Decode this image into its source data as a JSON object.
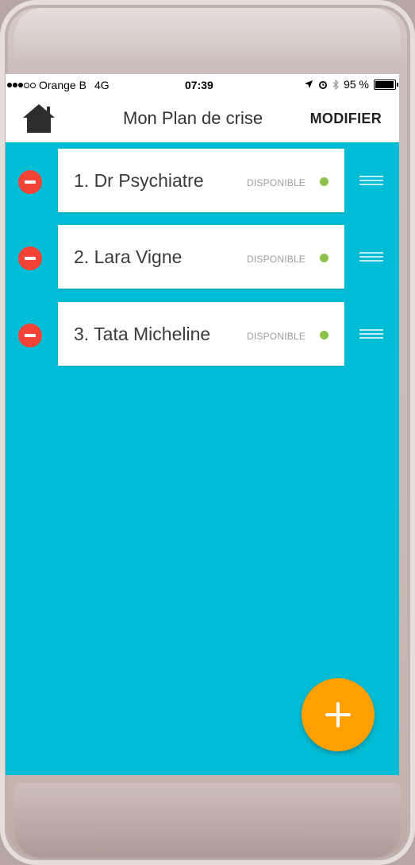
{
  "status_bar": {
    "carrier": "Orange B",
    "network": "4G",
    "time": "07:39",
    "battery": "95 %",
    "battery_level": 0.95
  },
  "header": {
    "title": "Mon Plan de crise",
    "modify_label": "MODIFIER",
    "home_icon": "home-icon"
  },
  "contacts": [
    {
      "name": "1. Dr Psychiatre",
      "status": "DISPONIBLE"
    },
    {
      "name": "2. Lara Vigne",
      "status": "DISPONIBLE"
    },
    {
      "name": "3. Tata Micheline",
      "status": "DISPONIBLE"
    }
  ],
  "colors": {
    "background": "#00bcd4",
    "remove": "#f44336",
    "available": "#8bc34a",
    "fab": "#ffa000"
  }
}
